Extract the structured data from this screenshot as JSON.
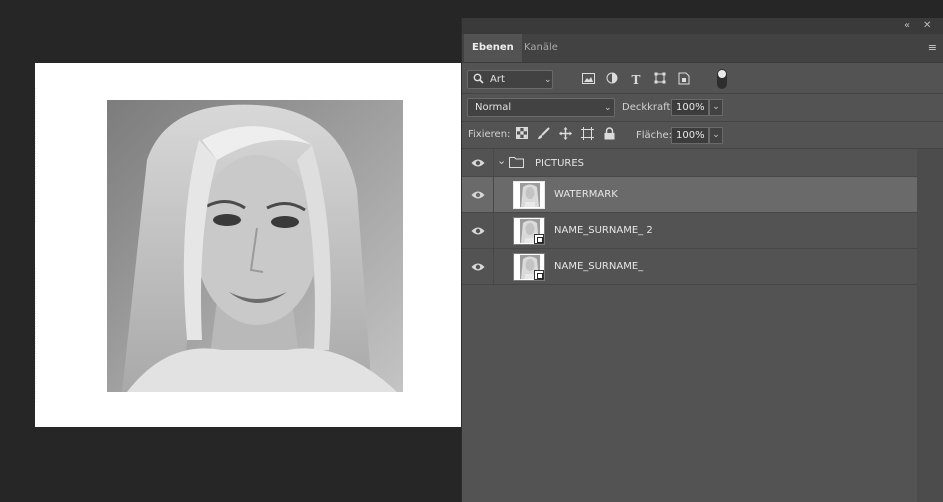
{
  "panel": {
    "collapse_icon": "double-chevron-left-icon",
    "close_icon": "close-icon",
    "tabs": [
      {
        "label": "Ebenen",
        "active": true
      },
      {
        "label": "Kanäle",
        "active": false
      }
    ],
    "menu_icon": "hamburger-menu-icon"
  },
  "filter": {
    "kind_label": "Art",
    "search_icon": "search-icon",
    "icons": [
      "image-filter-icon",
      "adjustment-filter-icon",
      "type-filter-icon",
      "shape-filter-icon",
      "smart-object-filter-icon"
    ],
    "toggle": "filter-toggle"
  },
  "blend": {
    "mode": "Normal",
    "opacity_label": "Deckkraft:",
    "opacity_value": "100%",
    "lock_label": "Fixieren:",
    "fill_label": "Fläche:",
    "fill_value": "100%",
    "lock_icons": [
      "lock-transparent-icon",
      "lock-paint-icon",
      "lock-position-icon",
      "lock-artboard-icon",
      "lock-all-icon"
    ]
  },
  "layers": [
    {
      "name": "PICTURES",
      "type": "group",
      "visible": true,
      "expanded": true,
      "selected": false
    },
    {
      "name": "WATERMARK",
      "type": "image",
      "visible": true,
      "selected": true
    },
    {
      "name": "NAME_SURNAME_ 2",
      "type": "smart-object",
      "visible": true,
      "selected": false
    },
    {
      "name": "NAME_SURNAME_",
      "type": "smart-object",
      "visible": true,
      "selected": false
    }
  ],
  "colors": {
    "workspace": "#262626",
    "panel": "#535353",
    "selected_layer": "#6a6a6a"
  }
}
